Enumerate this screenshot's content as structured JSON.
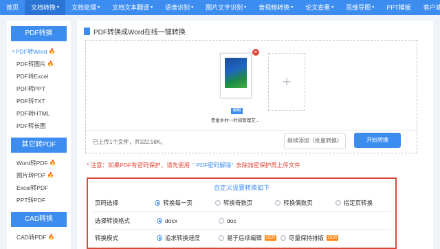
{
  "topnav": {
    "items": [
      {
        "label": "首页",
        "caret": ""
      },
      {
        "label": "文档转换",
        "caret": "▾"
      },
      {
        "label": "文档处理",
        "caret": "▾"
      },
      {
        "label": "文档文本翻译",
        "caret": "▾"
      },
      {
        "label": "语音识别",
        "caret": "▾"
      },
      {
        "label": "图片文字识别",
        "caret": "▾"
      },
      {
        "label": "音视频转换",
        "caret": "▾"
      },
      {
        "label": "论文查重",
        "caret": "▾"
      },
      {
        "label": "思维导图",
        "caret": "▾"
      },
      {
        "label": "PPT模板",
        "caret": ""
      },
      {
        "label": "客户端",
        "caret": "▾"
      }
    ]
  },
  "sidebar": {
    "sections": [
      {
        "title": "PDF转换",
        "items": [
          {
            "label": "PDF转Word",
            "dot": "•",
            "fire": "🔥"
          },
          {
            "label": "PDF转图片",
            "dot": "",
            "fire": "🔥"
          },
          {
            "label": "PDF转Excel",
            "dot": "",
            "fire": ""
          },
          {
            "label": "PDF转PPT",
            "dot": "",
            "fire": ""
          },
          {
            "label": "PDF转TXT",
            "dot": "",
            "fire": ""
          },
          {
            "label": "PDF转HTML",
            "dot": "",
            "fire": ""
          },
          {
            "label": "PDF转长图",
            "dot": "",
            "fire": ""
          }
        ]
      },
      {
        "title": "其它转PDF",
        "items": [
          {
            "label": "Word转PDF",
            "dot": "",
            "fire": "🔥"
          },
          {
            "label": "图片转PDF",
            "dot": "",
            "fire": "🔥"
          },
          {
            "label": "Excel转PDF",
            "dot": "",
            "fire": ""
          },
          {
            "label": "PPT转PDF",
            "dot": "",
            "fire": ""
          }
        ]
      },
      {
        "title": "CAD转换",
        "items": [
          {
            "label": "CAD转PDF",
            "dot": "",
            "fire": "🔥"
          }
        ]
      }
    ]
  },
  "main": {
    "title": "PDF转换成Word在线一键转换",
    "file": {
      "name": "贵金乡村一时间管理艺...",
      "edit_label": "编辑",
      "delete_icon": "×"
    },
    "add_icon": "+",
    "status_text": "已上传1个文件，共322.58K。",
    "batch_button": "继续添加（批量转换）",
    "start_button": "开始转换",
    "note": {
      "prefix": "* 注意：如果PDF有密码保护，请先使用",
      "link": "“ PDF密码解除”",
      "suffix": "去除加密保护再上传文件"
    },
    "settings": {
      "header": "自定义设置转换如下",
      "rows": [
        {
          "label": "页码选择",
          "options": [
            {
              "text": "转换每一页",
              "selected": true,
              "badge": ""
            },
            {
              "text": "转换奇数页",
              "selected": false,
              "badge": ""
            },
            {
              "text": "转换偶数页",
              "selected": false,
              "badge": ""
            },
            {
              "text": "指定页转换",
              "selected": false,
              "badge": ""
            }
          ]
        },
        {
          "label": "选择转换格式",
          "options": [
            {
              "text": "docx",
              "selected": true,
              "badge": ""
            },
            {
              "text": "doc",
              "selected": false,
              "badge": ""
            }
          ]
        },
        {
          "label": "转换模式",
          "options": [
            {
              "text": "追求转换速度",
              "selected": true,
              "badge": ""
            },
            {
              "text": "易于后续编辑",
              "selected": false,
              "badge": "OCR"
            },
            {
              "text": "尽量保持排版",
              "selected": false,
              "badge": "OCR"
            }
          ]
        }
      ]
    }
  },
  "colors": {
    "accent": "#3d8df0",
    "warning": "#e04a3a",
    "ocr_badge": "#ff8a1a"
  }
}
